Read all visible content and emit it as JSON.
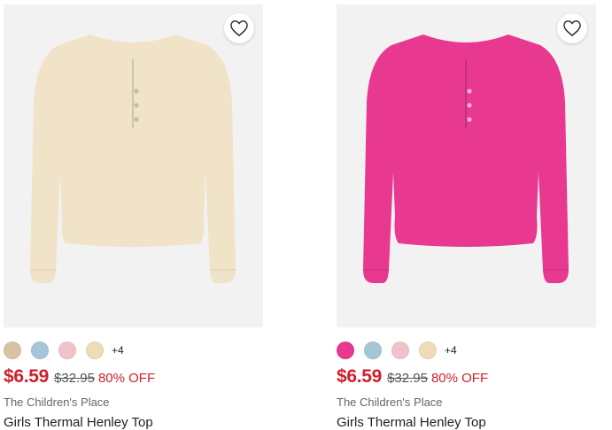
{
  "products": [
    {
      "image_alt": "Girls Thermal Henley Top",
      "garment_color": "#f1e3c8",
      "wishlist_icon": "heart-outline-icon",
      "swatches": [
        "#d9c2a2",
        "#a6c6d8",
        "#f0c3cb",
        "#eedbb8"
      ],
      "more_colors": "+4",
      "sale_price": "$6.59",
      "list_price": "$32.95",
      "discount": "80% OFF",
      "brand": "The Children's Place",
      "title": "Girls Thermal Henley Top"
    },
    {
      "image_alt": "Girls Thermal Henley Top",
      "garment_color": "#e8388f",
      "wishlist_icon": "heart-outline-icon",
      "swatches": [
        "#e8388f",
        "#a6c6d8",
        "#f0c3cb",
        "#eedbb8"
      ],
      "more_colors": "+4",
      "sale_price": "$6.59",
      "list_price": "$32.95",
      "discount": "80% OFF",
      "brand": "The Children's Place",
      "title": "Girls Thermal Henley Top"
    }
  ],
  "colors": {
    "sale": "#d01f2d",
    "image_bg": "#f2f2f2"
  }
}
